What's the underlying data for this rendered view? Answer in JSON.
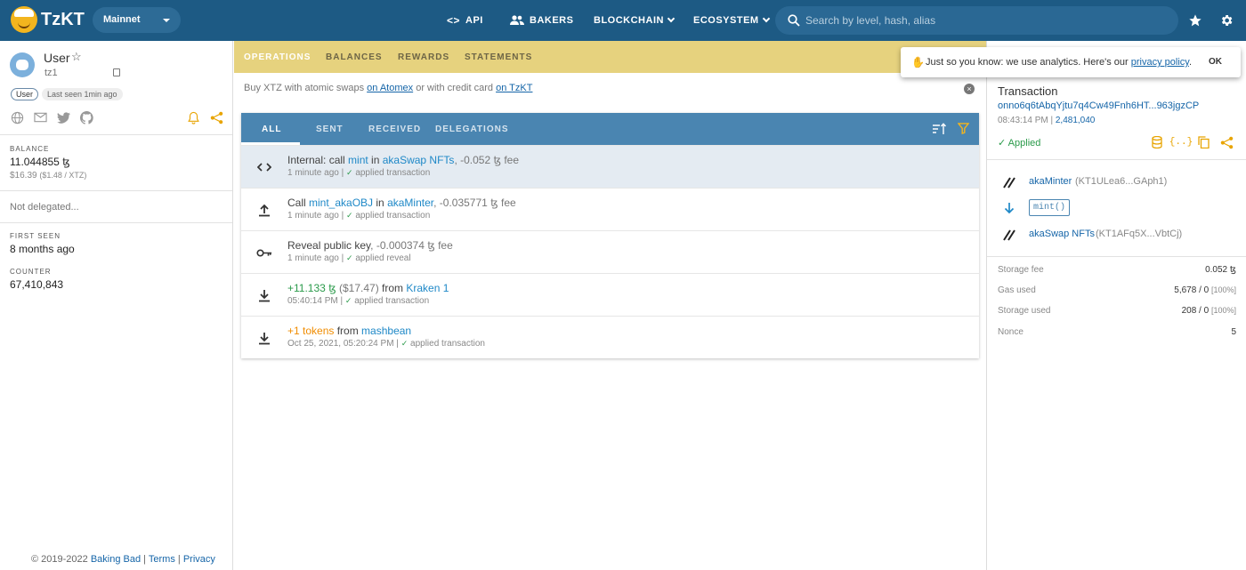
{
  "header": {
    "logo": "TzKT",
    "network": "Mainnet",
    "nav": {
      "api": "API",
      "bakers": "BAKERS",
      "blockchain": "BLOCKCHAIN",
      "ecosystem": "ECOSYSTEM"
    },
    "search_placeholder": "Search by level, hash, alias"
  },
  "account": {
    "name": "User",
    "address": "tz1",
    "type_badge": "User",
    "last_seen": "Last seen 1min ago",
    "balance_label": "BALANCE",
    "balance": "11.044855 ꜩ",
    "balance_usd": "$16.39",
    "rate": "($1.48 / XTZ)",
    "delegation": "Not delegated...",
    "first_seen_label": "FIRST SEEN",
    "first_seen": "8 months ago",
    "counter_label": "COUNTER",
    "counter": "67,410,843"
  },
  "footer": {
    "copyright": "© 2019-2022",
    "company": "Baking Bad",
    "terms": "Terms",
    "privacy": "Privacy",
    "sep": "|"
  },
  "main_tabs": [
    "OPERATIONS",
    "BALANCES",
    "REWARDS",
    "STATEMENTS"
  ],
  "buy": {
    "prefix": "Buy XTZ with atomic swaps",
    "link1": "on Atomex",
    "mid": "or with credit card",
    "link2": "on TzKT"
  },
  "op_tabs": [
    "ALL",
    "SENT",
    "RECEIVED",
    "DELEGATIONS"
  ],
  "operations": [
    {
      "p1": "Internal: call ",
      "entry": "mint",
      "p2": " in ",
      "target": "akaSwap NFTs",
      "fee": ", -0.052 ꜩ fee",
      "time": "1 minute ago",
      "status": "applied transaction"
    },
    {
      "p1": "Call ",
      "entry": "mint_akaOBJ",
      "p2": " in ",
      "target": "akaMinter",
      "fee": ", -0.035771 ꜩ fee",
      "time": "1 minute ago",
      "status": "applied transaction"
    },
    {
      "p1": "Reveal public key",
      "fee": ", -0.000374 ꜩ fee",
      "time": "1 minute ago",
      "status": "applied reveal"
    },
    {
      "amount": "+11.133 ꜩ",
      "usd": " ($17.47)",
      "from": " from ",
      "target": "Kraken 1",
      "time": "05:40:14 PM",
      "status": "applied transaction"
    },
    {
      "amount": "+1 tokens",
      "from": " from ",
      "target": "mashbean",
      "time": "Oct 25, 2021, 05:20:24 PM",
      "status": "applied transaction"
    }
  ],
  "detail": {
    "title": "Transaction",
    "hash": "onno6q6tAbqYjtu7q4Cw49Fnh6HT...963jgzCP",
    "time": "08:43:14 PM",
    "level": "2,481,040",
    "status": "Applied",
    "sender_name": "akaMinter",
    "sender_addr": "(KT1ULea6...GAph1)",
    "entrypoint": "mint()",
    "target_name": "akaSwap NFTs",
    "target_addr": "(KT1AFq5X...VbtCj)",
    "stats": [
      {
        "label": "Storage fee",
        "value": "0.052 ꜩ",
        "pct": ""
      },
      {
        "label": "Gas used",
        "value": "5,678 / 0",
        "pct": "[100%]"
      },
      {
        "label": "Storage used",
        "value": "208 / 0",
        "pct": "[100%]"
      },
      {
        "label": "Nonce",
        "value": "5",
        "pct": ""
      }
    ]
  },
  "popup": {
    "text": "Just so you know: we use analytics. Here's our",
    "link": "privacy policy",
    "dot": ".",
    "ok": "OK"
  }
}
